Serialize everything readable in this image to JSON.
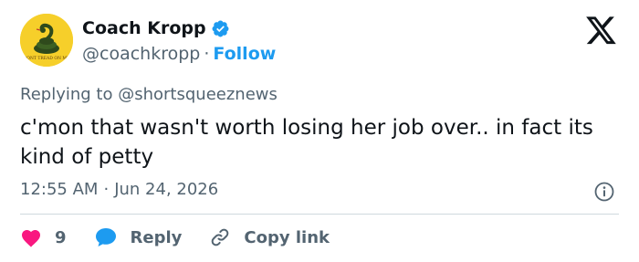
{
  "author": {
    "display_name": "Coach Kropp",
    "handle": "@coachkropp",
    "separator": "·",
    "follow_label": "Follow",
    "verified": true,
    "avatar_text": "DONT TREAD ON ME",
    "avatar_color": "#f6cf2a"
  },
  "reply_context": {
    "prefix": "Replying to",
    "mention": "@shortsqueeznews"
  },
  "tweet": {
    "text": "c'mon that wasn't worth losing her job over.. in fact its kind of petty",
    "time": "12:55 AM",
    "separator": "·",
    "date": "Jun 24, 2026"
  },
  "actions": {
    "like_count": "9",
    "reply_label": "Reply",
    "copy_label": "Copy link"
  },
  "icons": {
    "verified": "verified-badge-icon",
    "x_logo": "x-logo-icon",
    "info": "info-icon",
    "like": "heart-icon",
    "reply": "speech-bubble-icon",
    "copy": "link-icon"
  },
  "colors": {
    "like": "#f91880",
    "reply": "#1d9bf0",
    "follow": "#1d9bf0",
    "verified": "#1d9bf0",
    "secondary_text": "#536471"
  }
}
